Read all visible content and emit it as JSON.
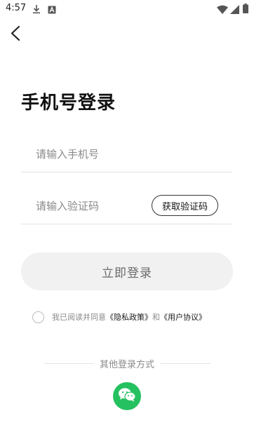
{
  "status_bar": {
    "time": "4:57",
    "icons": [
      "download-icon",
      "accessibility-icon",
      "wifi-icon",
      "signal-icon",
      "battery-icon"
    ]
  },
  "nav": {
    "back_icon": "chevron-left-icon"
  },
  "page": {
    "title": "手机号登录"
  },
  "form": {
    "phone": {
      "value": "",
      "placeholder": "请输入手机号"
    },
    "code": {
      "value": "",
      "placeholder": "请输入验证码"
    },
    "get_code_label": "获取验证码",
    "login_label": "立即登录"
  },
  "agreement": {
    "checked": false,
    "prefix": "我已阅读并同意",
    "privacy_link": "《隐私政策》",
    "conjunction": "和",
    "terms_link": "《用户协议》"
  },
  "other_login": {
    "label": "其他登录方式",
    "methods": [
      "wechat-icon"
    ]
  },
  "colors": {
    "wechat_green": "#25c160",
    "login_button_bg": "#f1f1f1",
    "divider": "#e3e3e3",
    "placeholder": "#8a8a8a"
  }
}
